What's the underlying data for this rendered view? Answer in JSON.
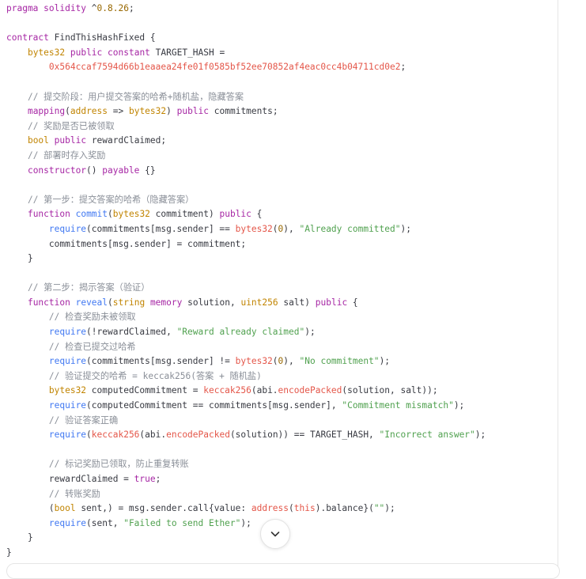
{
  "code_block": {
    "language": "solidity",
    "lines": [
      [
        {
          "t": "pragma solidity",
          "c": "kw"
        },
        {
          "t": " ^",
          "c": "pl"
        },
        {
          "t": "0.8.26",
          "c": "num"
        },
        {
          "t": ";",
          "c": "pl"
        }
      ],
      [],
      [
        {
          "t": "contract",
          "c": "kw"
        },
        {
          "t": " FindThisHashFixed {",
          "c": "pl"
        }
      ],
      [
        {
          "t": "    ",
          "c": "pl"
        },
        {
          "t": "bytes32",
          "c": "ty"
        },
        {
          "t": " ",
          "c": "pl"
        },
        {
          "t": "public",
          "c": "kw"
        },
        {
          "t": " ",
          "c": "pl"
        },
        {
          "t": "constant",
          "c": "kw"
        },
        {
          "t": " TARGET_HASH =",
          "c": "pl"
        }
      ],
      [
        {
          "t": "        ",
          "c": "pl"
        },
        {
          "t": "0x564ccaf7594d66b1eaaea24fe01f0585bf52ee70852af4eac0cc4b04711cd0e2",
          "c": "hex"
        },
        {
          "t": ";",
          "c": "pl"
        }
      ],
      [],
      [
        {
          "t": "    ",
          "c": "pl"
        },
        {
          "t": "// 提交阶段：用户提交答案的哈希+随机盐，隐藏答案",
          "c": "cm"
        }
      ],
      [
        {
          "t": "    ",
          "c": "pl"
        },
        {
          "t": "mapping",
          "c": "kw"
        },
        {
          "t": "(",
          "c": "pl"
        },
        {
          "t": "address",
          "c": "ty"
        },
        {
          "t": " => ",
          "c": "pl"
        },
        {
          "t": "bytes32",
          "c": "ty"
        },
        {
          "t": ") ",
          "c": "pl"
        },
        {
          "t": "public",
          "c": "kw"
        },
        {
          "t": " commitments;",
          "c": "pl"
        }
      ],
      [
        {
          "t": "    ",
          "c": "pl"
        },
        {
          "t": "// 奖励是否已被领取",
          "c": "cm"
        }
      ],
      [
        {
          "t": "    ",
          "c": "pl"
        },
        {
          "t": "bool",
          "c": "ty"
        },
        {
          "t": " ",
          "c": "pl"
        },
        {
          "t": "public",
          "c": "kw"
        },
        {
          "t": " rewardClaimed;",
          "c": "pl"
        }
      ],
      [
        {
          "t": "    ",
          "c": "pl"
        },
        {
          "t": "// 部署时存入奖励",
          "c": "cm"
        }
      ],
      [
        {
          "t": "    ",
          "c": "pl"
        },
        {
          "t": "constructor",
          "c": "kw"
        },
        {
          "t": "() ",
          "c": "pl"
        },
        {
          "t": "payable",
          "c": "kw"
        },
        {
          "t": " {}",
          "c": "pl"
        }
      ],
      [],
      [
        {
          "t": "    ",
          "c": "pl"
        },
        {
          "t": "// 第一步：提交答案的哈希（隐藏答案）",
          "c": "cm"
        }
      ],
      [
        {
          "t": "    ",
          "c": "pl"
        },
        {
          "t": "function",
          "c": "kw"
        },
        {
          "t": " ",
          "c": "pl"
        },
        {
          "t": "commit",
          "c": "fn"
        },
        {
          "t": "(",
          "c": "pl"
        },
        {
          "t": "bytes32",
          "c": "ty"
        },
        {
          "t": " commitment) ",
          "c": "pl"
        },
        {
          "t": "public",
          "c": "kw"
        },
        {
          "t": " {",
          "c": "pl"
        }
      ],
      [
        {
          "t": "        ",
          "c": "pl"
        },
        {
          "t": "require",
          "c": "fn"
        },
        {
          "t": "(commitments[msg.sender] == ",
          "c": "pl"
        },
        {
          "t": "bytes32",
          "c": "bi"
        },
        {
          "t": "(",
          "c": "pl"
        },
        {
          "t": "0",
          "c": "num"
        },
        {
          "t": "), ",
          "c": "pl"
        },
        {
          "t": "\"Already committed\"",
          "c": "str"
        },
        {
          "t": ");",
          "c": "pl"
        }
      ],
      [
        {
          "t": "        commitments[msg.sender] = commitment;",
          "c": "pl"
        }
      ],
      [
        {
          "t": "    }",
          "c": "pl"
        }
      ],
      [],
      [
        {
          "t": "    ",
          "c": "pl"
        },
        {
          "t": "// 第二步：揭示答案（验证）",
          "c": "cm"
        }
      ],
      [
        {
          "t": "    ",
          "c": "pl"
        },
        {
          "t": "function",
          "c": "kw"
        },
        {
          "t": " ",
          "c": "pl"
        },
        {
          "t": "reveal",
          "c": "fn"
        },
        {
          "t": "(",
          "c": "pl"
        },
        {
          "t": "string",
          "c": "ty"
        },
        {
          "t": " ",
          "c": "pl"
        },
        {
          "t": "memory",
          "c": "kw"
        },
        {
          "t": " solution, ",
          "c": "pl"
        },
        {
          "t": "uint256",
          "c": "ty"
        },
        {
          "t": " salt) ",
          "c": "pl"
        },
        {
          "t": "public",
          "c": "kw"
        },
        {
          "t": " {",
          "c": "pl"
        }
      ],
      [
        {
          "t": "        ",
          "c": "pl"
        },
        {
          "t": "// 检查奖励未被领取",
          "c": "cm"
        }
      ],
      [
        {
          "t": "        ",
          "c": "pl"
        },
        {
          "t": "require",
          "c": "fn"
        },
        {
          "t": "(!rewardClaimed, ",
          "c": "pl"
        },
        {
          "t": "\"Reward already claimed\"",
          "c": "str"
        },
        {
          "t": ");",
          "c": "pl"
        }
      ],
      [
        {
          "t": "        ",
          "c": "pl"
        },
        {
          "t": "// 检查已提交过哈希",
          "c": "cm"
        }
      ],
      [
        {
          "t": "        ",
          "c": "pl"
        },
        {
          "t": "require",
          "c": "fn"
        },
        {
          "t": "(commitments[msg.sender] != ",
          "c": "pl"
        },
        {
          "t": "bytes32",
          "c": "bi"
        },
        {
          "t": "(",
          "c": "pl"
        },
        {
          "t": "0",
          "c": "num"
        },
        {
          "t": "), ",
          "c": "pl"
        },
        {
          "t": "\"No commitment\"",
          "c": "str"
        },
        {
          "t": ");",
          "c": "pl"
        }
      ],
      [
        {
          "t": "        ",
          "c": "pl"
        },
        {
          "t": "// 验证提交的哈希 = keccak256(答案 + 随机盐)",
          "c": "cm"
        }
      ],
      [
        {
          "t": "        ",
          "c": "pl"
        },
        {
          "t": "bytes32",
          "c": "ty"
        },
        {
          "t": " computedCommitment = ",
          "c": "pl"
        },
        {
          "t": "keccak256",
          "c": "bi"
        },
        {
          "t": "(abi.",
          "c": "pl"
        },
        {
          "t": "encodePacked",
          "c": "bi"
        },
        {
          "t": "(solution, salt));",
          "c": "pl"
        }
      ],
      [
        {
          "t": "        ",
          "c": "pl"
        },
        {
          "t": "require",
          "c": "fn"
        },
        {
          "t": "(computedCommitment == commitments[msg.sender], ",
          "c": "pl"
        },
        {
          "t": "\"Commitment mismatch\"",
          "c": "str"
        },
        {
          "t": ");",
          "c": "pl"
        }
      ],
      [
        {
          "t": "        ",
          "c": "pl"
        },
        {
          "t": "// 验证答案正确",
          "c": "cm"
        }
      ],
      [
        {
          "t": "        ",
          "c": "pl"
        },
        {
          "t": "require",
          "c": "fn"
        },
        {
          "t": "(",
          "c": "pl"
        },
        {
          "t": "keccak256",
          "c": "bi"
        },
        {
          "t": "(abi.",
          "c": "pl"
        },
        {
          "t": "encodePacked",
          "c": "bi"
        },
        {
          "t": "(solution)) == TARGET_HASH, ",
          "c": "pl"
        },
        {
          "t": "\"Incorrect answer\"",
          "c": "str"
        },
        {
          "t": ");",
          "c": "pl"
        }
      ],
      [],
      [
        {
          "t": "        ",
          "c": "pl"
        },
        {
          "t": "// 标记奖励已领取，防止重复转账",
          "c": "cm"
        }
      ],
      [
        {
          "t": "        rewardClaimed = ",
          "c": "pl"
        },
        {
          "t": "true",
          "c": "kw"
        },
        {
          "t": ";",
          "c": "pl"
        }
      ],
      [
        {
          "t": "        ",
          "c": "pl"
        },
        {
          "t": "// 转账奖励",
          "c": "cm"
        }
      ],
      [
        {
          "t": "        (",
          "c": "pl"
        },
        {
          "t": "bool",
          "c": "ty"
        },
        {
          "t": " sent,) = msg.sender.call{value: ",
          "c": "pl"
        },
        {
          "t": "address",
          "c": "bi"
        },
        {
          "t": "(",
          "c": "pl"
        },
        {
          "t": "this",
          "c": "bi"
        },
        {
          "t": ").balance}(",
          "c": "pl"
        },
        {
          "t": "\"\"",
          "c": "str"
        },
        {
          "t": ");",
          "c": "pl"
        }
      ],
      [
        {
          "t": "        ",
          "c": "pl"
        },
        {
          "t": "require",
          "c": "fn"
        },
        {
          "t": "(sent, ",
          "c": "pl"
        },
        {
          "t": "\"Failed to send Ether\"",
          "c": "str"
        },
        {
          "t": ");",
          "c": "pl"
        }
      ],
      [
        {
          "t": "    }",
          "c": "pl"
        }
      ],
      [
        {
          "t": "}",
          "c": "pl"
        }
      ]
    ]
  },
  "scroll_button": {
    "icon": "chevron-down-icon"
  },
  "colors": {
    "keyword": "#a626a4",
    "type": "#c18401",
    "string": "#50a14f",
    "number": "#986801",
    "hex_literal": "#e45649",
    "comment": "#8a8f98",
    "function": "#4078f2",
    "plain": "#383a42"
  }
}
